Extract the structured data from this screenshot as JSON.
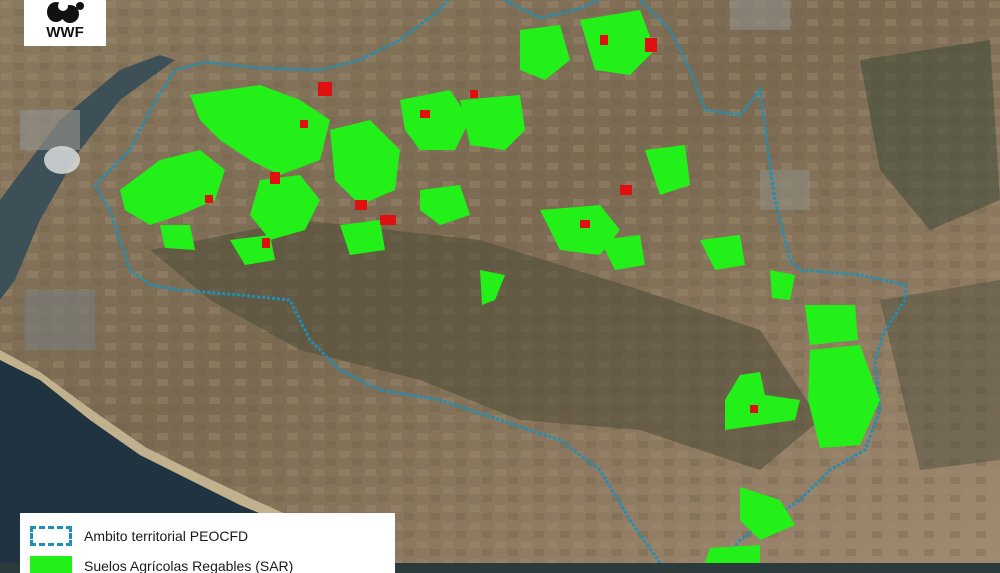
{
  "logo": {
    "text": "WWF",
    "icon": "panda-icon"
  },
  "map": {
    "boundary_color": "#1f8fb8",
    "irrigated_color": "#22f018",
    "other_parcels_color": "#e01010"
  },
  "legend": {
    "items": [
      {
        "label": "Ambito territorial PEOCFD",
        "swatch": "dashed-blue-outline"
      },
      {
        "label": "Suelos Agrícolas Regables (SAR)",
        "swatch": "solid-green"
      }
    ]
  }
}
